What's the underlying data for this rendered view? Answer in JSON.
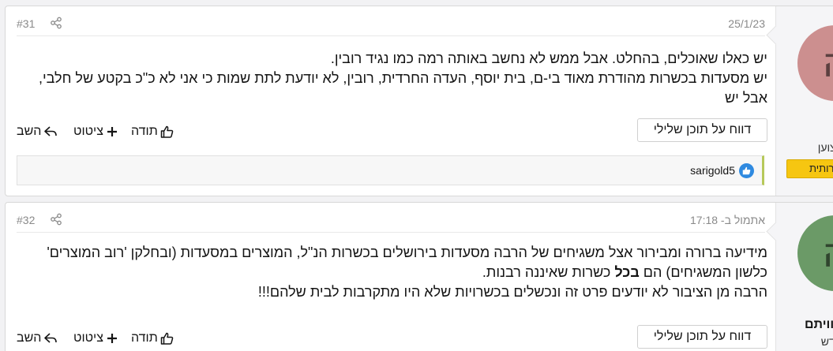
{
  "posts": [
    {
      "number": "#31",
      "date": "25/1/23",
      "user": {
        "name": "ה",
        "title": "קצוען",
        "badge": "רותית",
        "avatar_letter": "ה"
      },
      "message": {
        "line1": "יש כאלו שאוכלים, בהחלט. אבל ממש לא נחשב באותה רמה כמו נגיד רובין.",
        "line2": "יש מסעדות בכשרות מהודרת מאוד בי-ם, בית יוסף, העדה החרדית, רובין, לא יודעת לתת שמות כי אני לא כ\"כ בקטע של חלבי,",
        "line3": "אבל יש"
      },
      "actions": {
        "reply": "השב",
        "quote": "ציטוט",
        "thanks": "תודה",
        "report": "דווח על תוכן שלילי"
      },
      "reactions": {
        "users": "sarigold5"
      },
      "icons": [
        "share-icon",
        "reply-icon",
        "plus-icon",
        "thumbs-up-icon",
        "like-badge-icon"
      ]
    },
    {
      "number": "#32",
      "date": "אתמול ב- 17:18",
      "user": {
        "name": "הוויתם",
        "title": "חדש",
        "avatar_letter": "ה"
      },
      "message": {
        "line1": "מידיעה ברורה ומבירור אצל משגיחים של הרבה מסעדות בירושלים בכשרות הנ\"ל, המוצרים במסעדות (ובחלקן 'רוב המוצרים'",
        "line2_pre": "כלשון המשגיחים) הם ",
        "line2_bold": "בכל",
        "line2_post": " כשרות שאיננה רבנות.",
        "line3": "הרבה מן הציבור לא יודעים פרט זה ונכשלים בכשרויות שלא היו מתקרבות לבית שלהם!!!"
      },
      "actions": {
        "reply": "השב",
        "quote": "ציטוט",
        "thanks": "תודה",
        "report": "דווח על תוכן שלילי"
      }
    }
  ],
  "colors": {
    "avatar_1": "#cc8f8f",
    "avatar_2": "#6b9a67",
    "badge": "#f6c611",
    "reaction_accent": "#b7c95a",
    "like_blue": "#2f8ae0"
  }
}
